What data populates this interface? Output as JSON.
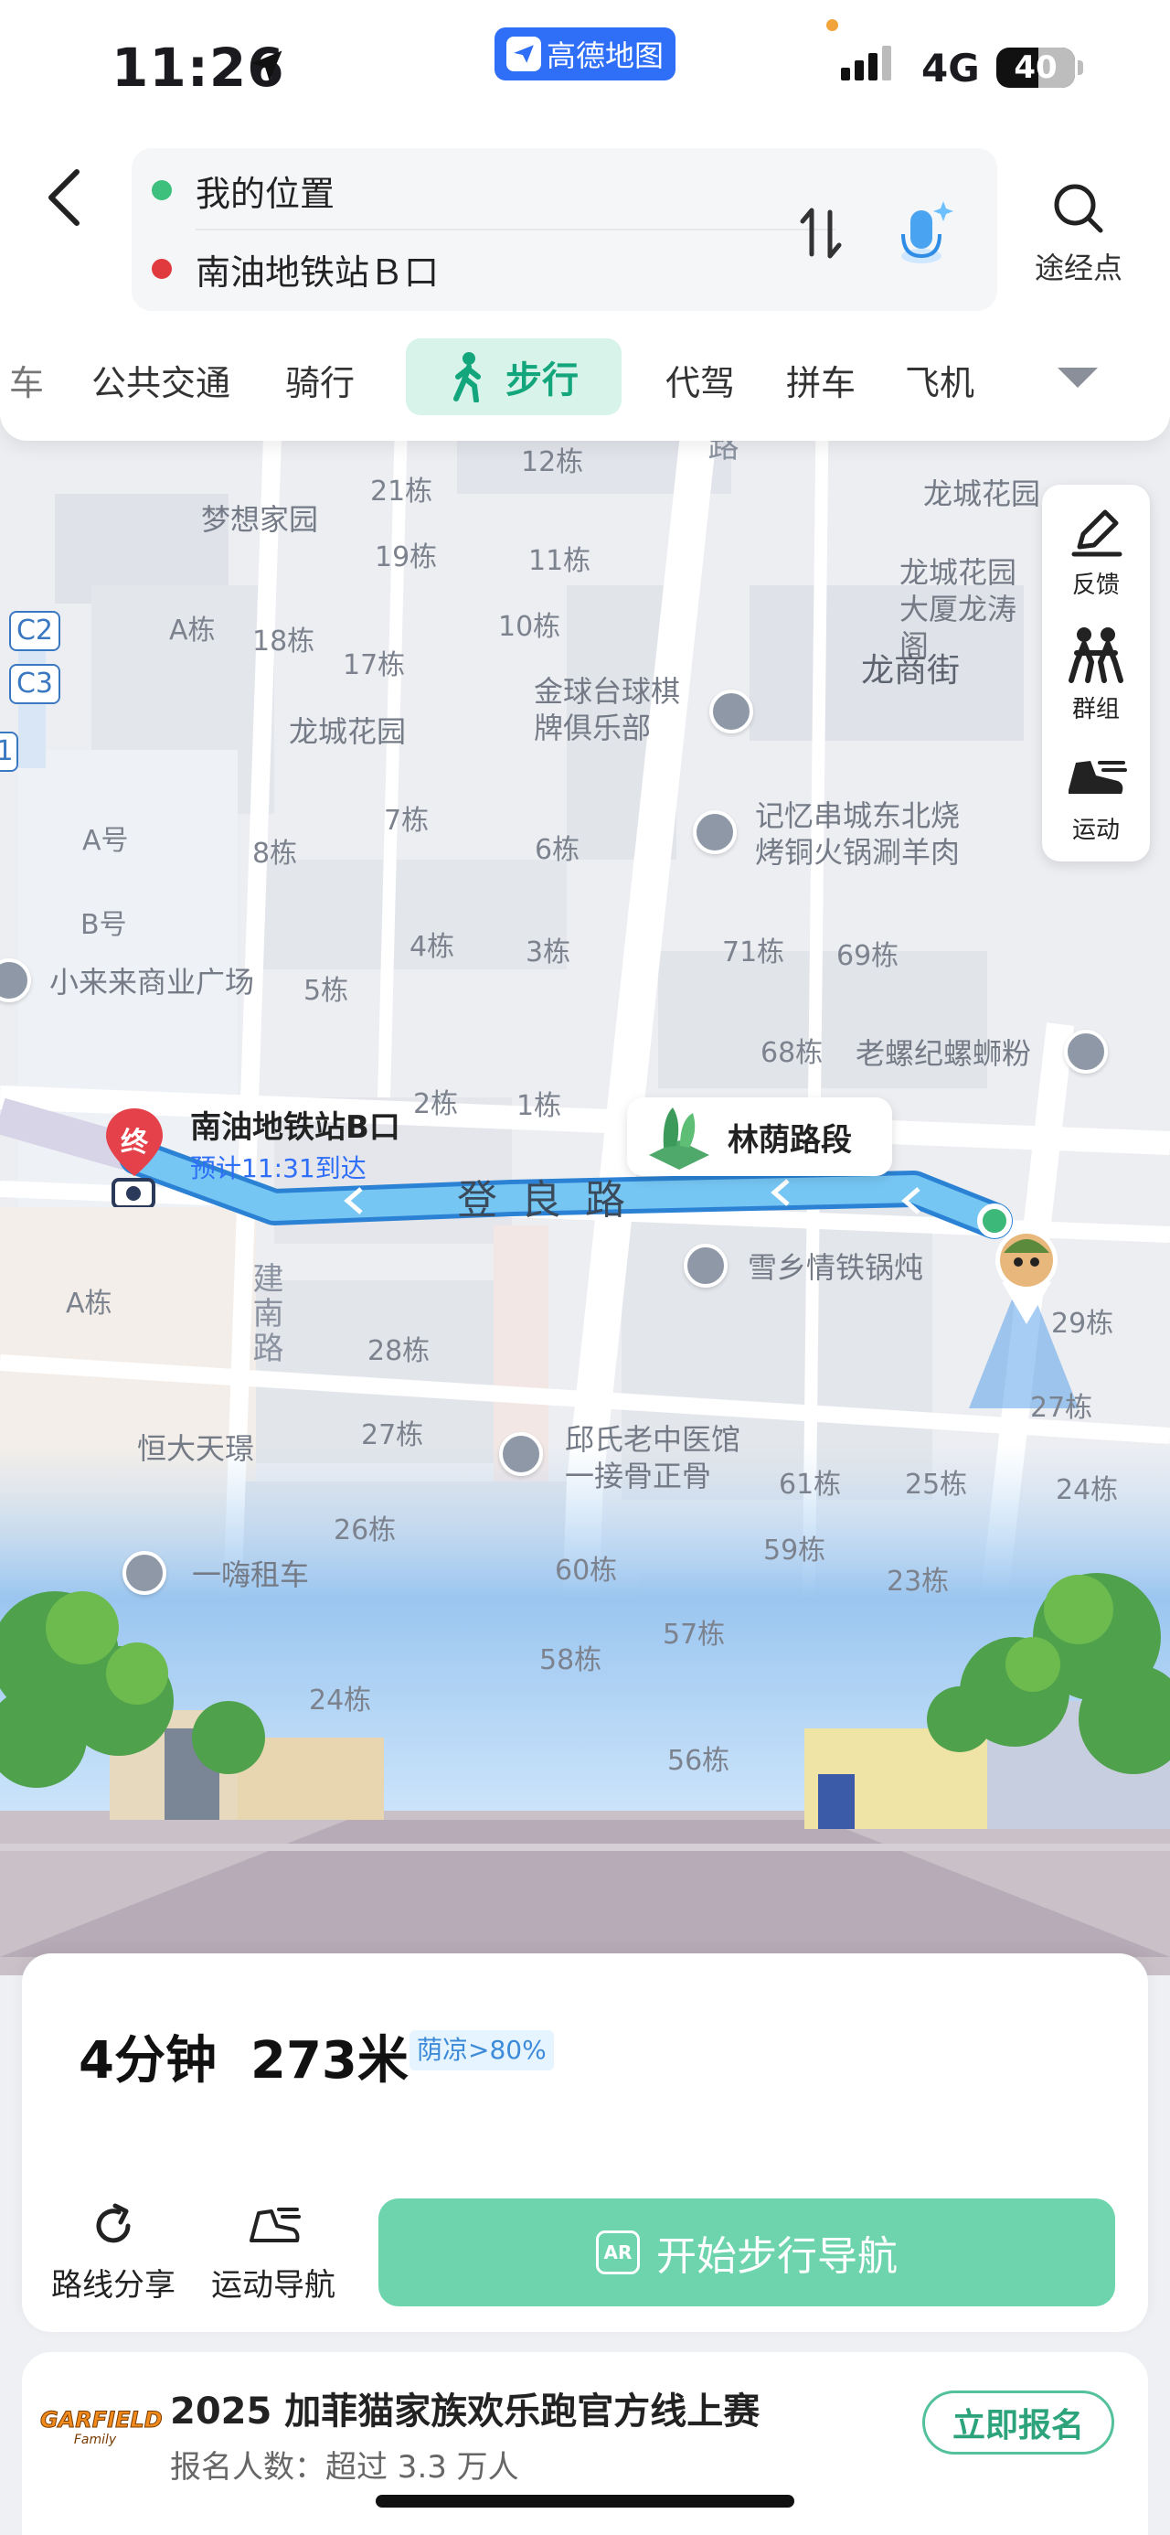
{
  "status_bar": {
    "time": "11:26",
    "app_name": "高德地图",
    "network": "4G",
    "battery": "40"
  },
  "search": {
    "origin": "我的位置",
    "destination": "南油地铁站Ｂ口",
    "via_label": "途经点"
  },
  "modes": {
    "items": [
      "车",
      "公共交通",
      "骑行",
      "步行",
      "代驾",
      "拼车",
      "飞机"
    ],
    "active": "步行"
  },
  "side_tools": {
    "feedback": "反馈",
    "group": "群组",
    "sport": "运动"
  },
  "map": {
    "buildings": [
      "21栋",
      "12栋",
      "19栋",
      "11栋",
      "A栋",
      "18栋",
      "17栋",
      "10栋",
      "8栋",
      "7栋",
      "6栋",
      "4栋",
      "3栋",
      "5栋",
      "2栋",
      "1栋",
      "71栋",
      "69栋",
      "68栋",
      "28栋",
      "27栋",
      "26栋",
      "60栋",
      "61栋",
      "25栋",
      "24栋",
      "59栋",
      "23栋",
      "57栋",
      "58栋",
      "24栋",
      "56栋",
      "29栋",
      "27栋",
      "A号",
      "B号",
      "A栋"
    ],
    "pois": {
      "dream_home": "梦想家园",
      "longcheng_garden": "龙城花园",
      "longcheng_garden_top": "龙城花园",
      "longcheng_garden_xia": "龙城花园大厦龙涛阁",
      "longshang_street": "龙商街",
      "golf": "金球台球棋牌俱乐部",
      "skewer": "记忆串城东北烧烤铜火锅涮羊肉",
      "xiaolailai": "小来来商业广场",
      "luosifen": "老螺纪螺蛳粉",
      "hotpot": "雪乡情铁锅炖",
      "clinic": "邱氏老中医馆一接骨正骨",
      "hengda": "恒大天璟",
      "rental": "一嗨租车"
    },
    "route_codes": [
      "C2",
      "C3",
      "1"
    ],
    "road_name": "登良路",
    "road_vertical": "建南路",
    "road_top": "路"
  },
  "destination": {
    "name": "南油地铁站B口",
    "end_marker": "终",
    "eta": "预计11:31到达"
  },
  "shade_tag": "林荫路段",
  "summary": {
    "duration": "4分钟",
    "distance": "273米",
    "shade_badge": "荫凉>80%",
    "share_label": "路线分享",
    "sport_nav_label": "运动导航",
    "start_label": "开始步行导航",
    "ar_label": "AR"
  },
  "promo": {
    "logo_text": "GARFIELD",
    "logo_sub": "Family",
    "title": "2025 加菲猫家族欢乐跑官方线上赛",
    "subtitle": "报名人数：超过 3.3 万人",
    "button": "立即报名"
  },
  "colors": {
    "accent": "#13a57b",
    "button": "#6dd4ae",
    "route_blue": "#3aa0e8",
    "app_blue": "#2f6ef7"
  }
}
